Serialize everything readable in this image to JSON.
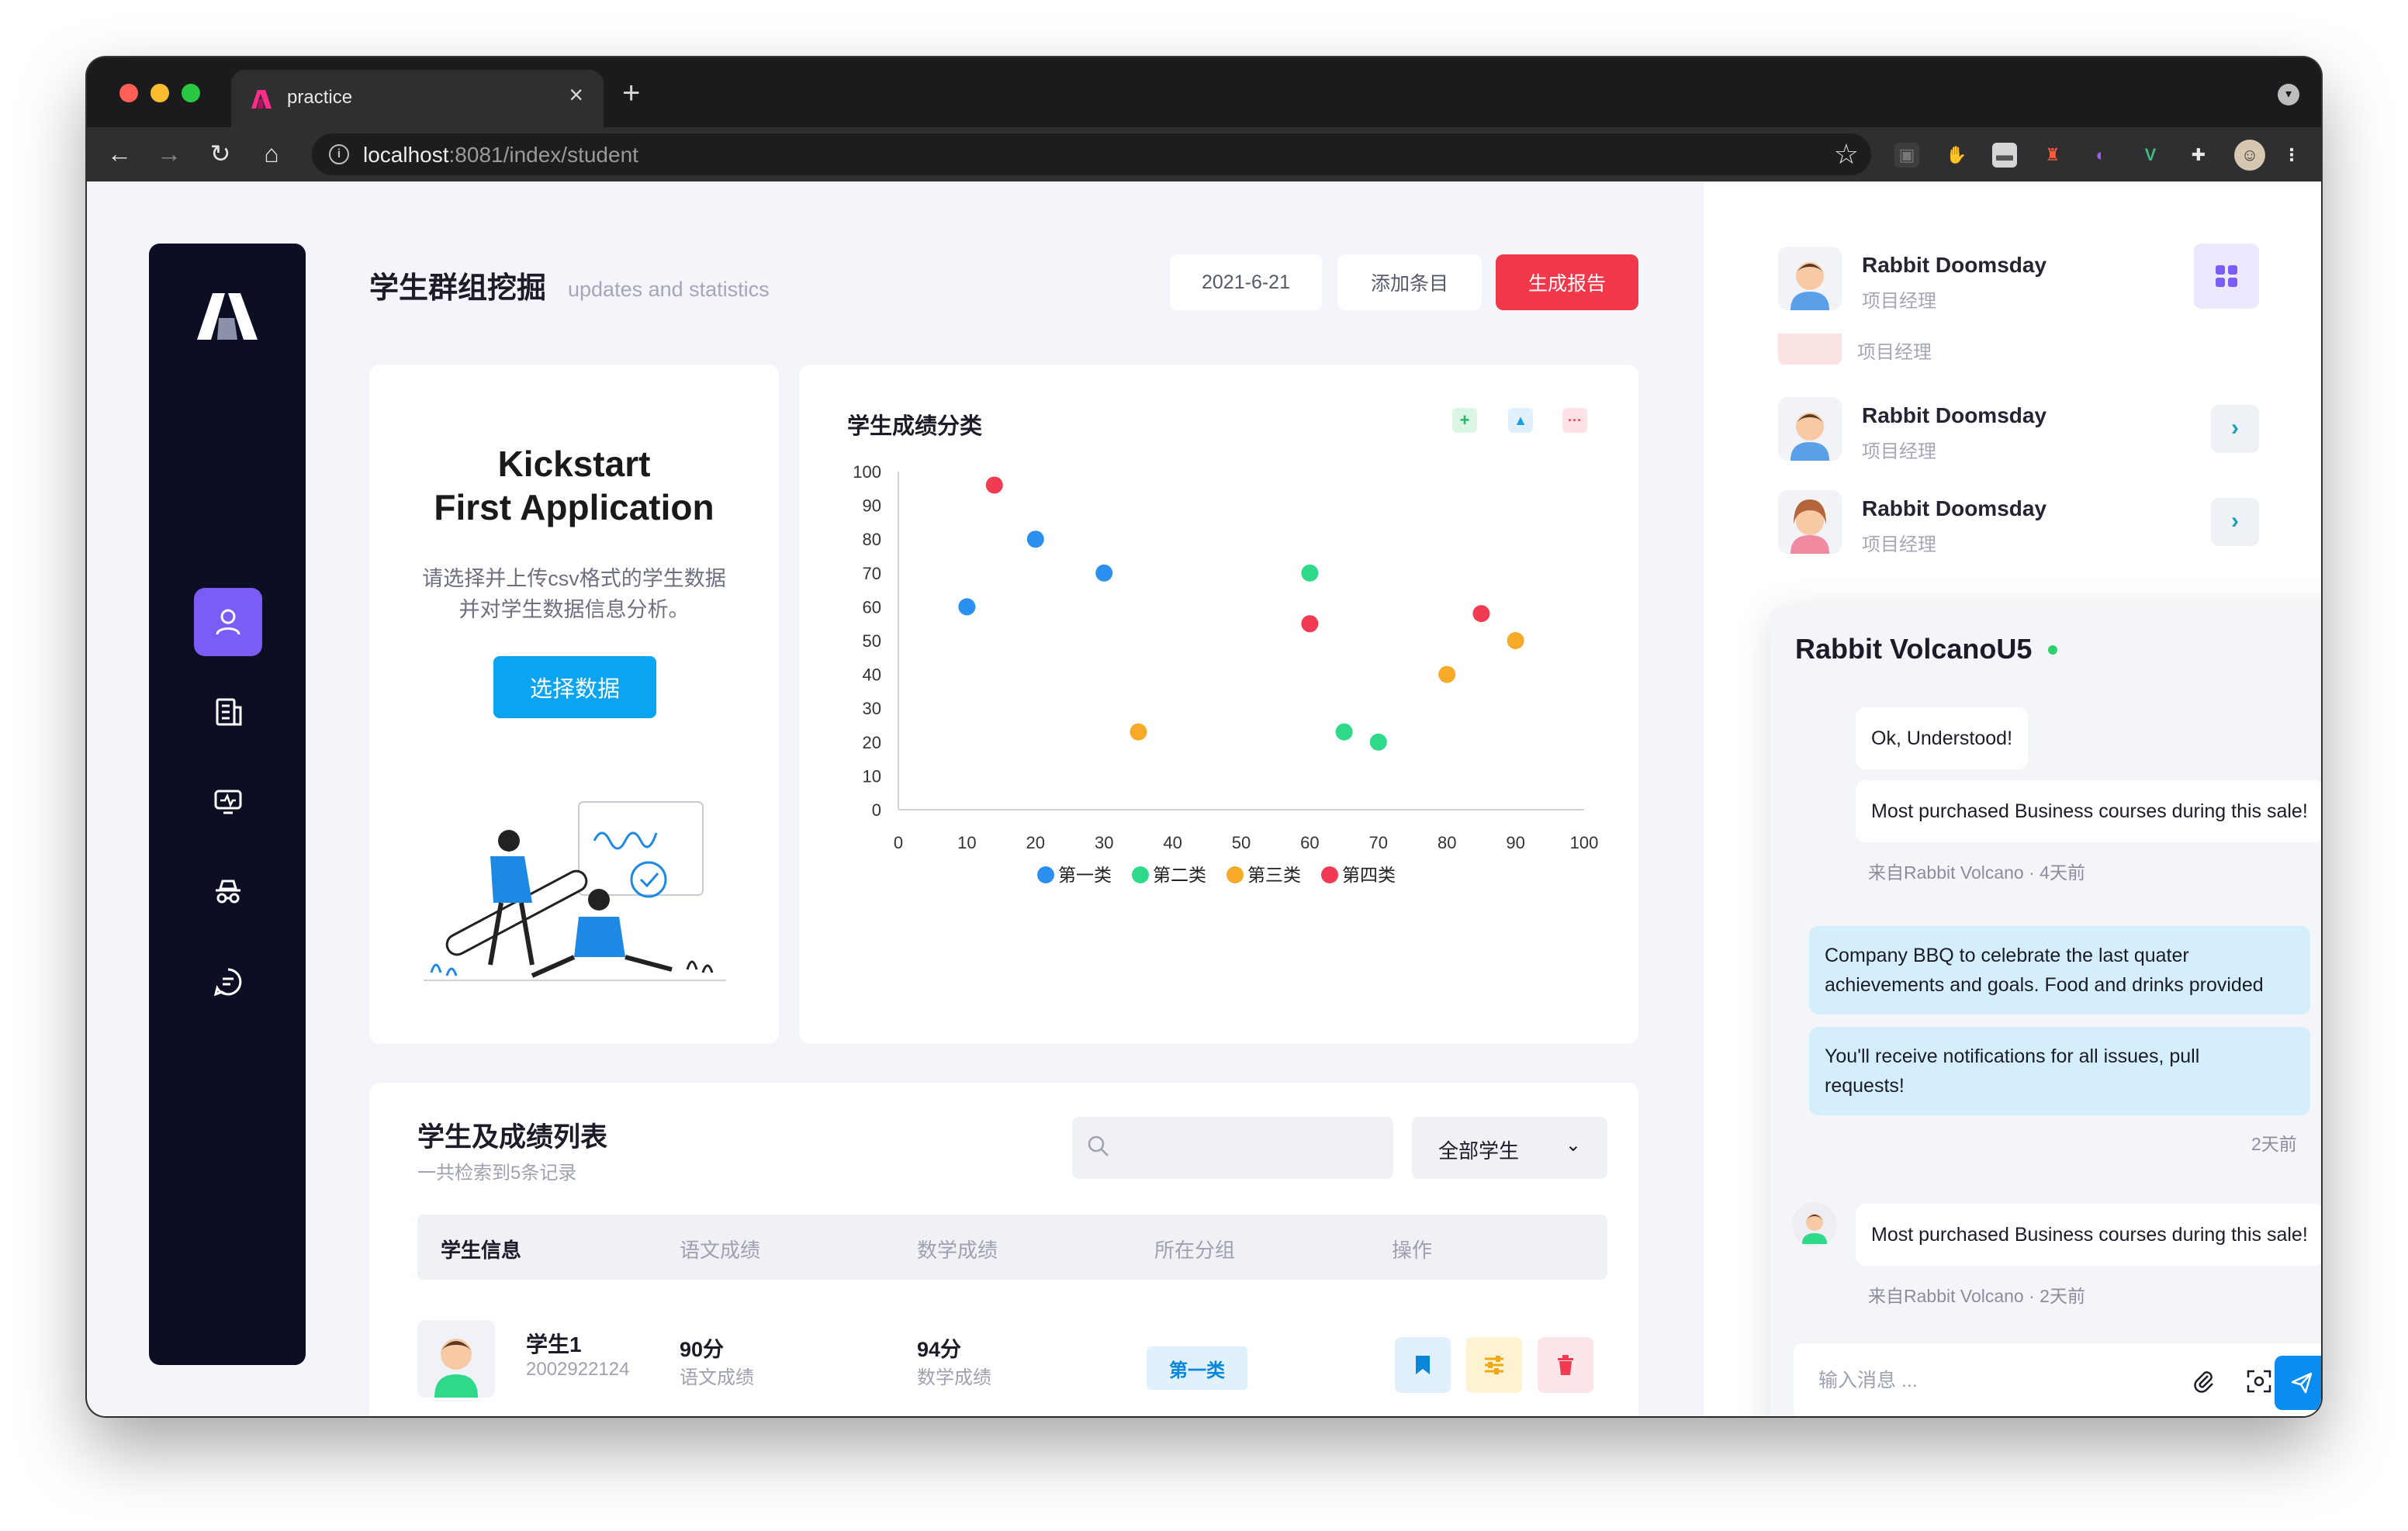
{
  "browser": {
    "tab_title": "practice",
    "url_host": "localhost",
    "url_path": ":8081/index/student"
  },
  "header": {
    "title": "学生群组挖掘",
    "subtitle": "updates and statistics",
    "date_button": "2021-6-21",
    "add_button": "添加条目",
    "report_button": "生成报告"
  },
  "sidebar": {
    "items": [
      {
        "icon": "user-icon",
        "active": true
      },
      {
        "icon": "building-icon",
        "active": false
      },
      {
        "icon": "monitor-icon",
        "active": false
      },
      {
        "icon": "incognito-icon",
        "active": false
      },
      {
        "icon": "chat-icon",
        "active": false
      }
    ]
  },
  "kickstart": {
    "title_line1": "Kickstart",
    "title_line2": "First Application",
    "desc_line1": "请选择并上传csv格式的学生数据",
    "desc_line2": "并对学生数据信息分析。",
    "button": "选择数据"
  },
  "chart_card": {
    "title": "学生成绩分类"
  },
  "chart_data": {
    "type": "scatter",
    "title": "学生成绩分类",
    "xlim": [
      0,
      100
    ],
    "ylim": [
      0,
      100
    ],
    "x_ticks": [
      0,
      10,
      20,
      30,
      40,
      50,
      60,
      70,
      80,
      90,
      100
    ],
    "y_ticks": [
      0,
      10,
      20,
      30,
      40,
      50,
      60,
      70,
      80,
      90,
      100
    ],
    "legend_position": "bottom",
    "series": [
      {
        "name": "第一类",
        "color": "#2b8ff0",
        "points": [
          [
            10,
            60
          ],
          [
            20,
            80
          ],
          [
            30,
            70
          ]
        ]
      },
      {
        "name": "第二类",
        "color": "#2fd98a",
        "points": [
          [
            60,
            70
          ],
          [
            65,
            23
          ],
          [
            70,
            20
          ]
        ]
      },
      {
        "name": "第三类",
        "color": "#f7a928",
        "points": [
          [
            35,
            23
          ],
          [
            80,
            40
          ],
          [
            90,
            50
          ]
        ]
      },
      {
        "name": "第四类",
        "color": "#f03b52",
        "points": [
          [
            14,
            96
          ],
          [
            60,
            55
          ],
          [
            85,
            58
          ]
        ]
      }
    ]
  },
  "table": {
    "title": "学生及成绩列表",
    "subtitle": "一共检索到5条记录",
    "search_placeholder": "",
    "filter_value": "全部学生",
    "headers": [
      "学生信息",
      "语文成绩",
      "数学成绩",
      "所在分组",
      "操作"
    ],
    "rows": [
      {
        "name": "学生1",
        "id": "2002922124",
        "chinese": "90分",
        "chinese_label": "语文成绩",
        "math": "94分",
        "math_label": "数学成绩",
        "group": "第一类"
      }
    ]
  },
  "contacts": [
    {
      "name": "Rabbit Doomsday",
      "role": "项目经理"
    },
    {
      "name": "",
      "role": "项目经理"
    },
    {
      "name": "Rabbit Doomsday",
      "role": "项目经理"
    },
    {
      "name": "Rabbit Doomsday",
      "role": "项目经理"
    }
  ],
  "chat": {
    "title": "Rabbit VolcanoU5",
    "messages": [
      {
        "text": "Ok, Understood!"
      },
      {
        "text": "Most purchased Business courses during this sale!"
      },
      {
        "meta": "来自Rabbit Volcano · 4天前"
      },
      {
        "text_line1": "Company BBQ to celebrate the last quater",
        "text_line2": "achievements and goals. Food and drinks provided"
      },
      {
        "text_line1": "You'll receive notifications for all issues, pull",
        "text_line2": "requests!"
      },
      {
        "meta": "2天前"
      },
      {
        "text": "Most purchased Business courses during this sale!"
      },
      {
        "meta": "来自Rabbit Volcano · 2天前"
      }
    ],
    "input_placeholder": "输入消息 ..."
  }
}
